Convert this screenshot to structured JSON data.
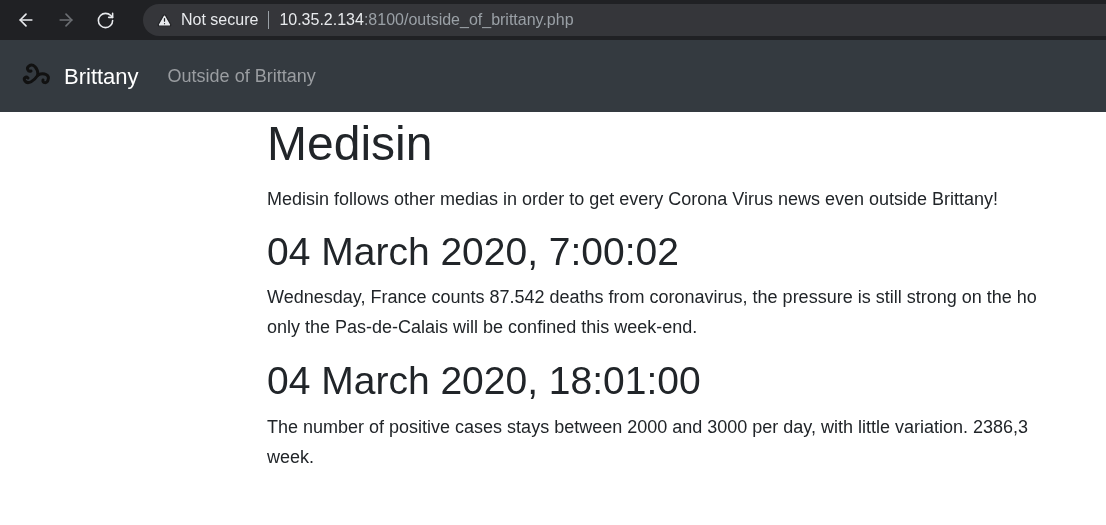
{
  "browser": {
    "back": {
      "disabled": false
    },
    "forward": {
      "disabled": true
    },
    "security_label": "Not secure",
    "url_host": "10.35.2.134",
    "url_path": ":8100/outside_of_brittany.php"
  },
  "navbar": {
    "brand": "Brittany",
    "links": [
      {
        "label": "Outside of Brittany",
        "active": false
      }
    ]
  },
  "content": {
    "title": "Medisin",
    "lead": "Medisin follows other medias in order to get every Corona Virus news even outside Brittany!",
    "posts": [
      {
        "heading": "04 March 2020, 7:00:02",
        "lines": [
          "Wednesday, France counts 87.542 deaths from coronavirus, the pressure is still strong on the ho",
          "only the Pas-de-Calais will be confined this week-end."
        ]
      },
      {
        "heading": "04 March 2020, 18:01:00",
        "lines": [
          "The number of positive cases stays between 2000 and 3000 per day, with little variation. 2386,3",
          "week."
        ]
      }
    ]
  }
}
